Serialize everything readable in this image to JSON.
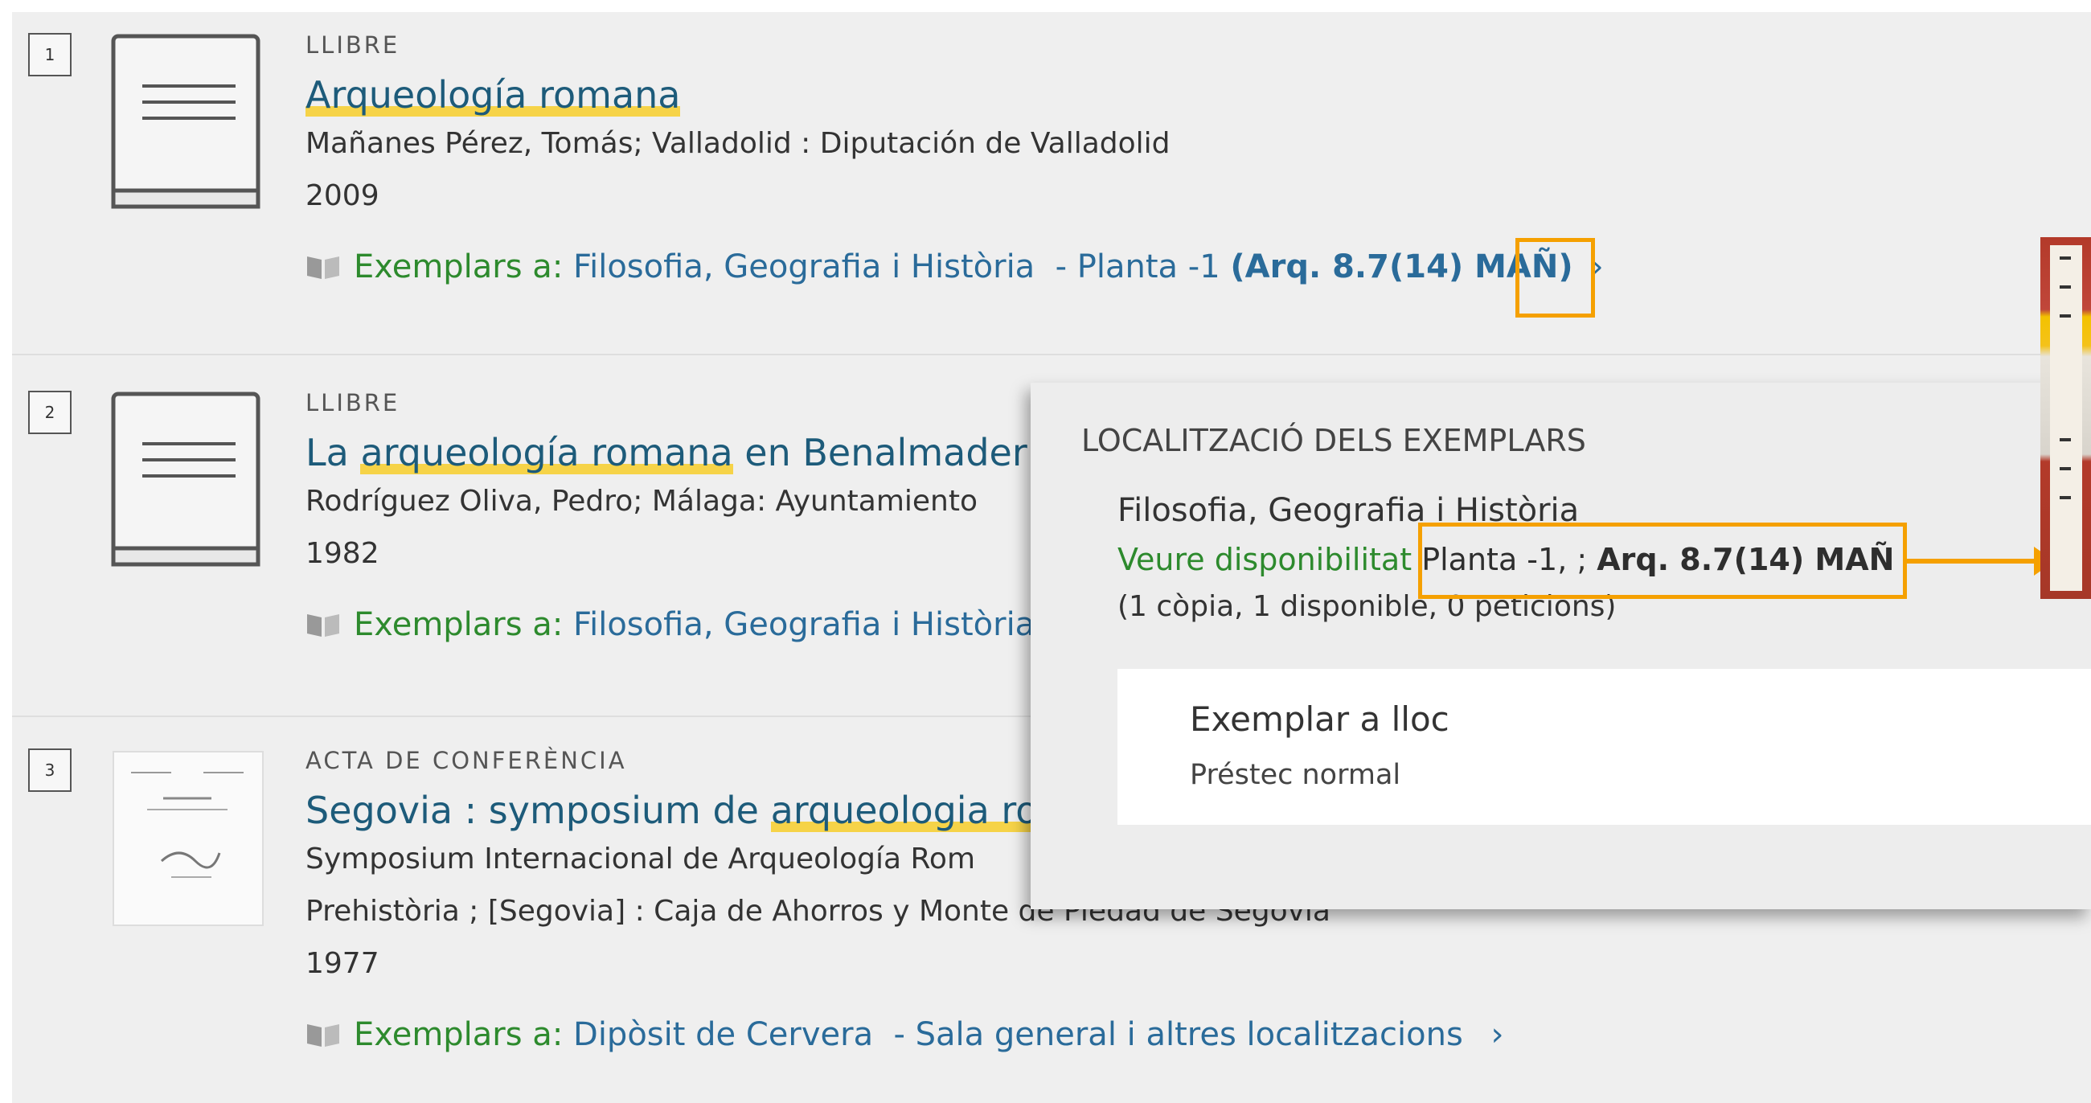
{
  "results": [
    {
      "number": "1",
      "type": "LLIBRE",
      "title_pre": "",
      "title_hl": "Arqueología romana",
      "title_post": "",
      "authors": "Mañanes Pérez, Tomás; Valladolid : Diputación de Valladolid",
      "year": "2009",
      "holdings_label": "Exemplars a:",
      "holdings_location": " Filosofia, Geografia i Història  - Planta -1 ",
      "holdings_call": "(Arq. 8.7(14) MAÑ)",
      "chevron": "›"
    },
    {
      "number": "2",
      "type": "LLIBRE",
      "title_pre": "La ",
      "title_hl": "arqueología romana",
      "title_post": " en Benalmader",
      "authors": "Rodríguez Oliva, Pedro; Málaga: Ayuntamiento",
      "year": "1982",
      "holdings_label": "Exemplars a:",
      "holdings_location": " Filosofia, Geografia i Història",
      "holdings_call": "",
      "chevron": ""
    },
    {
      "number": "3",
      "type": "ACTA DE CONFERÈNCIA",
      "title_pre": "Segovia : symposium de ",
      "title_hl": "arqueologia ro",
      "title_post": "",
      "authors": "Symposium Internacional de Arqueología Rom",
      "authors_line2": "Prehistòria ; [Segovia] : Caja de Ahorros y Monte de Piedad de Segovia",
      "year": "1977",
      "holdings_label": "Exemplars a:",
      "holdings_location": " Dipòsit de Cervera  - Sala general i altres localitzacions ",
      "holdings_call": "",
      "chevron": "›"
    }
  ],
  "popup": {
    "heading": "LOCALITZACIÓ DELS EXEMPLARS",
    "library": "Filosofia, Geografia i Història",
    "availability_link": "Veure disponibilitat",
    "location_text": " Planta -1, ; ",
    "location_call": "Arq. 8.7(14) MAÑ",
    "copies": "(1 còpia, 1 disponible, 0 peticions)",
    "item_title": "Exemplar a lloc",
    "item_policy": "Préstec normal"
  },
  "colors": {
    "highlight": "#f6d348",
    "annotation_orange": "#f5a000",
    "available_green": "#2d8a2d",
    "link_blue": "#2a6b9a"
  }
}
